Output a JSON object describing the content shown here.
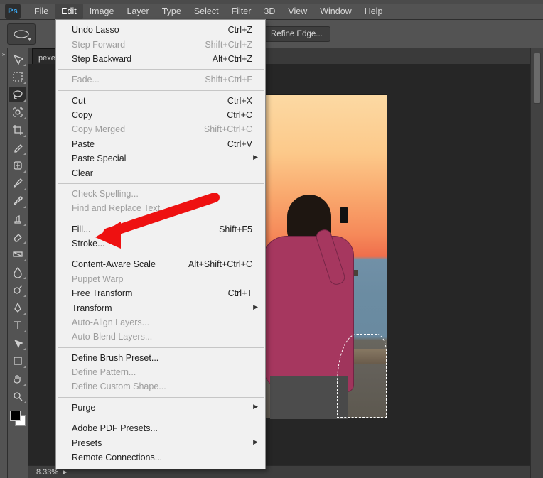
{
  "app": {
    "logo_text": "Ps"
  },
  "menubar": {
    "items": [
      "File",
      "Edit",
      "Image",
      "Layer",
      "Type",
      "Select",
      "Filter",
      "3D",
      "View",
      "Window",
      "Help"
    ],
    "open_index": 1
  },
  "optionsbar": {
    "refine_edge_label": "Refine Edge..."
  },
  "document": {
    "tab_label": "pexe",
    "zoom_label": "8.33%"
  },
  "tools": [
    {
      "name": "move-tool"
    },
    {
      "name": "marquee-tool"
    },
    {
      "name": "lasso-tool",
      "active": true
    },
    {
      "name": "quick-select-tool"
    },
    {
      "name": "crop-tool"
    },
    {
      "name": "eyedropper-tool"
    },
    {
      "name": "healing-brush-tool"
    },
    {
      "name": "brush-tool"
    },
    {
      "name": "history-brush-tool"
    },
    {
      "name": "clone-stamp-tool"
    },
    {
      "name": "eraser-tool"
    },
    {
      "name": "gradient-tool"
    },
    {
      "name": "blur-tool"
    },
    {
      "name": "dodge-tool"
    },
    {
      "name": "pen-tool"
    },
    {
      "name": "type-tool"
    },
    {
      "name": "path-select-tool"
    },
    {
      "name": "shape-tool"
    },
    {
      "name": "hand-tool"
    },
    {
      "name": "zoom-tool"
    }
  ],
  "edit_menu": [
    {
      "label": "Undo Lasso",
      "shortcut": "Ctrl+Z"
    },
    {
      "label": "Step Forward",
      "shortcut": "Shift+Ctrl+Z",
      "disabled": true
    },
    {
      "label": "Step Backward",
      "shortcut": "Alt+Ctrl+Z"
    },
    {
      "sep": true
    },
    {
      "label": "Fade...",
      "shortcut": "Shift+Ctrl+F",
      "disabled": true
    },
    {
      "sep": true
    },
    {
      "label": "Cut",
      "shortcut": "Ctrl+X"
    },
    {
      "label": "Copy",
      "shortcut": "Ctrl+C"
    },
    {
      "label": "Copy Merged",
      "shortcut": "Shift+Ctrl+C",
      "disabled": true
    },
    {
      "label": "Paste",
      "shortcut": "Ctrl+V"
    },
    {
      "label": "Paste Special",
      "submenu": true
    },
    {
      "label": "Clear"
    },
    {
      "sep": true
    },
    {
      "label": "Check Spelling...",
      "disabled": true
    },
    {
      "label": "Find and Replace Text...",
      "disabled": true
    },
    {
      "sep": true
    },
    {
      "label": "Fill...",
      "shortcut": "Shift+F5"
    },
    {
      "label": "Stroke..."
    },
    {
      "sep": true
    },
    {
      "label": "Content-Aware Scale",
      "shortcut": "Alt+Shift+Ctrl+C"
    },
    {
      "label": "Puppet Warp",
      "disabled": true
    },
    {
      "label": "Free Transform",
      "shortcut": "Ctrl+T"
    },
    {
      "label": "Transform",
      "submenu": true
    },
    {
      "label": "Auto-Align Layers...",
      "disabled": true
    },
    {
      "label": "Auto-Blend Layers...",
      "disabled": true
    },
    {
      "sep": true
    },
    {
      "label": "Define Brush Preset..."
    },
    {
      "label": "Define Pattern...",
      "disabled": true
    },
    {
      "label": "Define Custom Shape...",
      "disabled": true
    },
    {
      "sep": true
    },
    {
      "label": "Purge",
      "submenu": true
    },
    {
      "sep": true
    },
    {
      "label": "Adobe PDF Presets..."
    },
    {
      "label": "Presets",
      "submenu": true
    },
    {
      "label": "Remote Connections..."
    }
  ]
}
